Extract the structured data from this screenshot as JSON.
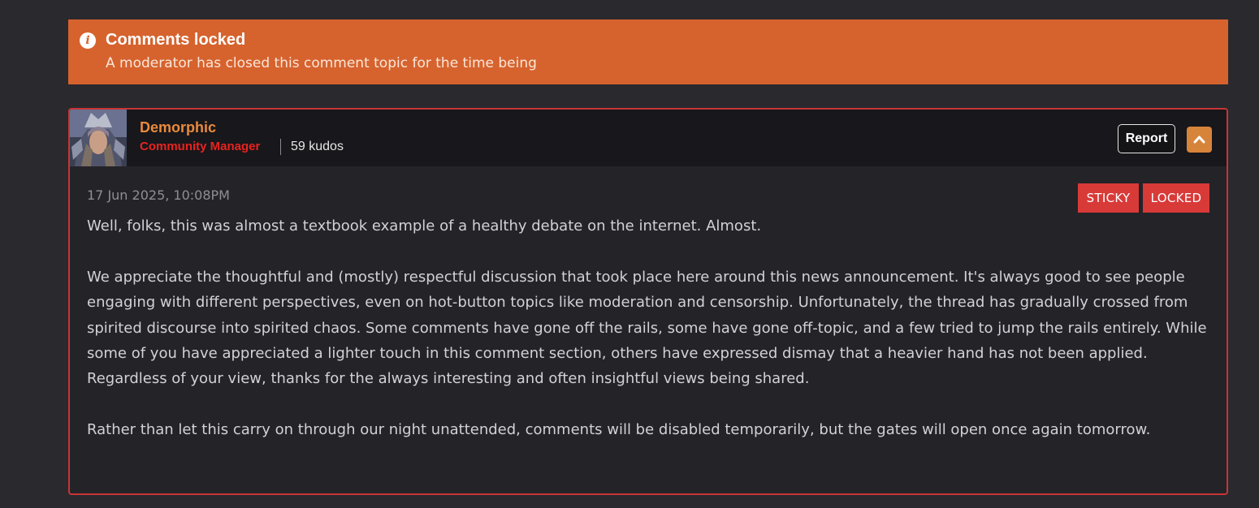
{
  "banner": {
    "icon": "info-icon",
    "icon_glyph": "i",
    "title": "Comments locked",
    "subtitle": "A moderator has closed this comment topic for the time being",
    "color": "#d6632e"
  },
  "comment": {
    "author": {
      "name": "Demorphic",
      "role": "Community Manager",
      "kudos": "59 kudos",
      "avatar": "avatar-image",
      "name_color": "#e98a3c",
      "role_color": "#e8231f"
    },
    "actions": {
      "report_label": "Report",
      "collapse_icon": "chevron-up-icon"
    },
    "timestamp": "17 Jun 2025, 10:08PM",
    "tags": {
      "sticky": "STICKY",
      "locked": "LOCKED",
      "color": "#d83a38"
    },
    "border_color": "#c73535",
    "paragraphs": [
      "Well, folks, this was almost a textbook example of a healthy debate on the internet. Almost.",
      "We appreciate the thoughtful and (mostly) respectful discussion that took place here around this news announcement. It's always good to see people engaging with different perspectives, even on hot-button topics like moderation and censorship. Unfortunately, the thread has gradually crossed from spirited discourse into spirited chaos. Some comments have gone off the rails, some have gone off-topic, and a few tried to jump the rails entirely. While some of you have appreciated a lighter touch in this comment section, others have expressed dismay that a heavier hand has not been applied. Regardless of your view, thanks for the always interesting and often insightful views being shared.",
      "Rather than let this carry on through our night unattended, comments will be disabled temporarily, but the gates will open once again tomorrow."
    ]
  }
}
